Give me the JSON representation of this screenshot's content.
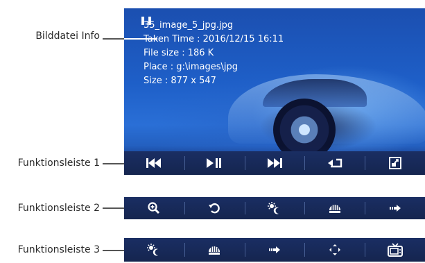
{
  "labels": {
    "info": "Bilddatei Info",
    "toolbar1": "Funktionsleiste 1",
    "toolbar2": "Funktionsleiste 2",
    "toolbar3": "Funktionsleiste 3"
  },
  "info": {
    "filename": "35_image_5_jpg.jpg",
    "taken_time": "Taken Time : 2016/12/15 16:11",
    "file_size": "File size : 186 K",
    "place": "Place : g:\\images\\jpg",
    "size": "Size : 877 x 547"
  },
  "toolbar1": {
    "buttons": [
      {
        "icon": "skip-previous-icon"
      },
      {
        "icon": "play-pause-icon"
      },
      {
        "icon": "skip-next-icon"
      },
      {
        "icon": "return-icon"
      },
      {
        "icon": "fullscreen-icon"
      }
    ]
  },
  "toolbar2": {
    "buttons": [
      {
        "icon": "zoom-in-icon"
      },
      {
        "icon": "rotate-icon"
      },
      {
        "icon": "brightness-icon"
      },
      {
        "icon": "equalizer-icon"
      },
      {
        "icon": "arrow-right-icon"
      }
    ]
  },
  "toolbar3": {
    "buttons": [
      {
        "icon": "brightness-icon"
      },
      {
        "icon": "equalizer-icon"
      },
      {
        "icon": "arrow-right-icon"
      },
      {
        "icon": "move-icon"
      },
      {
        "icon": "tv-icon"
      }
    ]
  },
  "colors": {
    "toolbar_bg": "#15254f",
    "screen_blue": "#1e5fc8",
    "text_white": "#ffffff"
  }
}
